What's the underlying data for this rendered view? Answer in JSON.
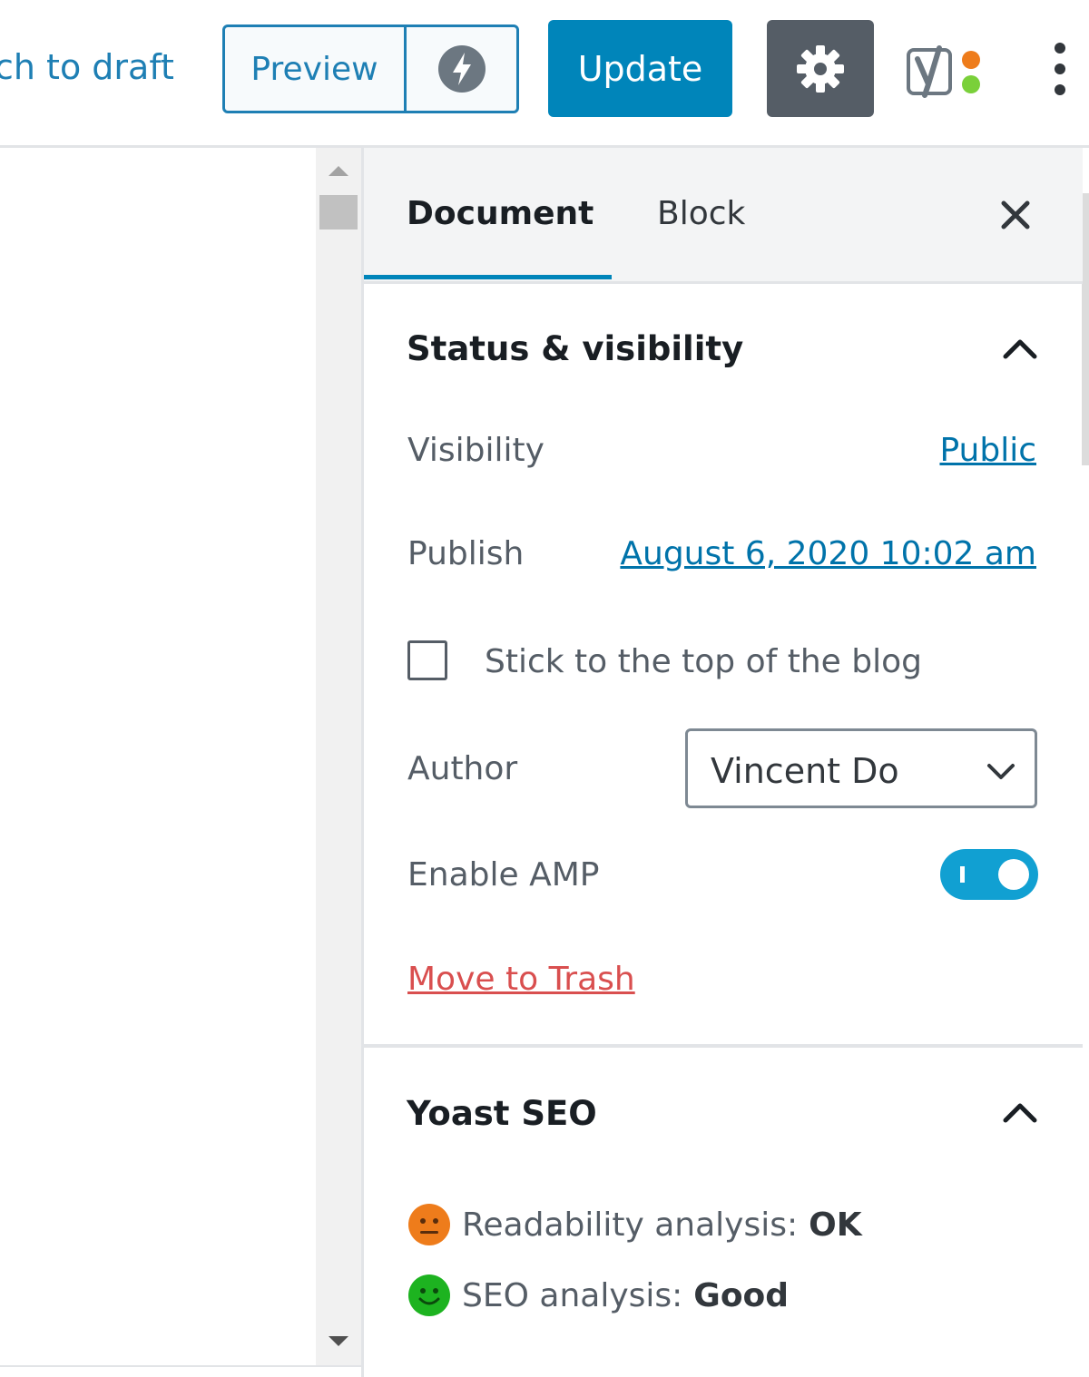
{
  "toolbar": {
    "switch_to_draft": "ch to draft",
    "preview_label": "Preview",
    "update_label": "Update"
  },
  "sidebar": {
    "tabs": [
      {
        "label": "Document",
        "active": true
      },
      {
        "label": "Block",
        "active": false
      }
    ],
    "status_visibility": {
      "title": "Status & visibility",
      "visibility_label": "Visibility",
      "visibility_value": "Public",
      "publish_label": "Publish",
      "publish_value": "August 6, 2020 10:02 am",
      "sticky_label": "Stick to the top of the blog",
      "sticky_checked": false,
      "author_label": "Author",
      "author_value": "Vincent Do",
      "amp_label": "Enable AMP",
      "amp_enabled": true,
      "trash_label": "Move to Trash"
    },
    "yoast": {
      "title": "Yoast SEO",
      "readability_label": "Readability analysis:",
      "readability_value": "OK",
      "seo_label": "SEO analysis:",
      "seo_value": "Good"
    }
  },
  "colors": {
    "accent": "#0085ba",
    "link": "#0073aa",
    "trash": "#d94f4f",
    "ok_face": "#ee7c1b",
    "good_face": "#1db320"
  },
  "icons": [
    "amp-lightning-icon",
    "gear-icon",
    "yoast-icon",
    "more-vertical-icon",
    "close-icon",
    "chevron-up-icon",
    "chevron-down-icon",
    "neutral-face-icon",
    "smiley-face-icon"
  ]
}
